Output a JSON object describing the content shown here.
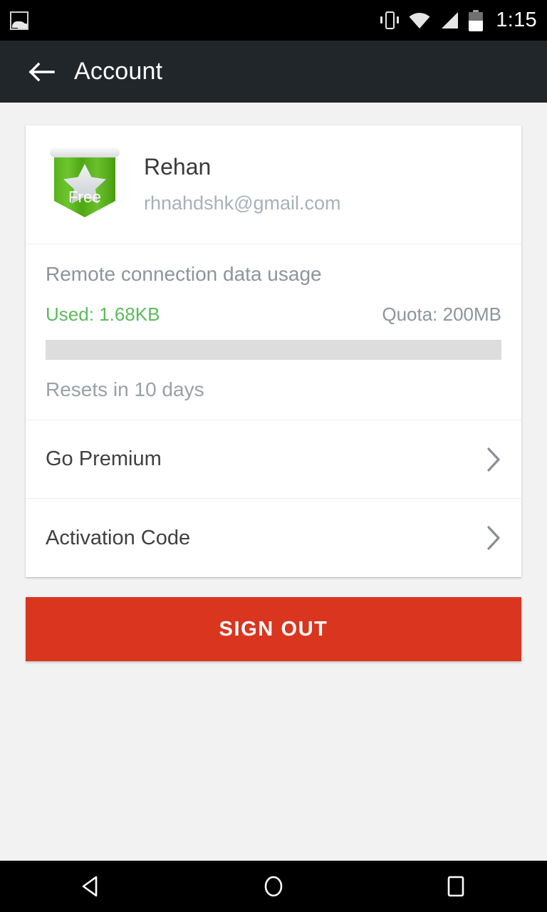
{
  "statusbar": {
    "time": "1:15",
    "icons": [
      "gallery-icon",
      "vibrate-icon",
      "wifi-icon",
      "signal-icon",
      "battery-icon"
    ]
  },
  "appbar": {
    "back_icon": "back-arrow-icon",
    "title": "Account"
  },
  "account": {
    "badge": {
      "label": "Free",
      "star_icon": "star-icon",
      "color": "#55b51c"
    },
    "name": "Rehan",
    "email": "rhnahdshk@gmail.com"
  },
  "usage": {
    "title": "Remote connection data usage",
    "used_label": "Used: 1.68KB",
    "quota_label": "Quota: 200MB",
    "used_color": "#5cba5c",
    "progress_percent": 0,
    "reset_label": "Resets in 10 days"
  },
  "rows": [
    {
      "label": "Go Premium",
      "chevron": "chevron-right-icon"
    },
    {
      "label": "Activation Code",
      "chevron": "chevron-right-icon"
    }
  ],
  "signout": {
    "label": "SIGN OUT",
    "color": "#d9351f"
  },
  "navbar": {
    "back": "nav-back-icon",
    "home": "nav-home-icon",
    "recents": "nav-recents-icon"
  }
}
